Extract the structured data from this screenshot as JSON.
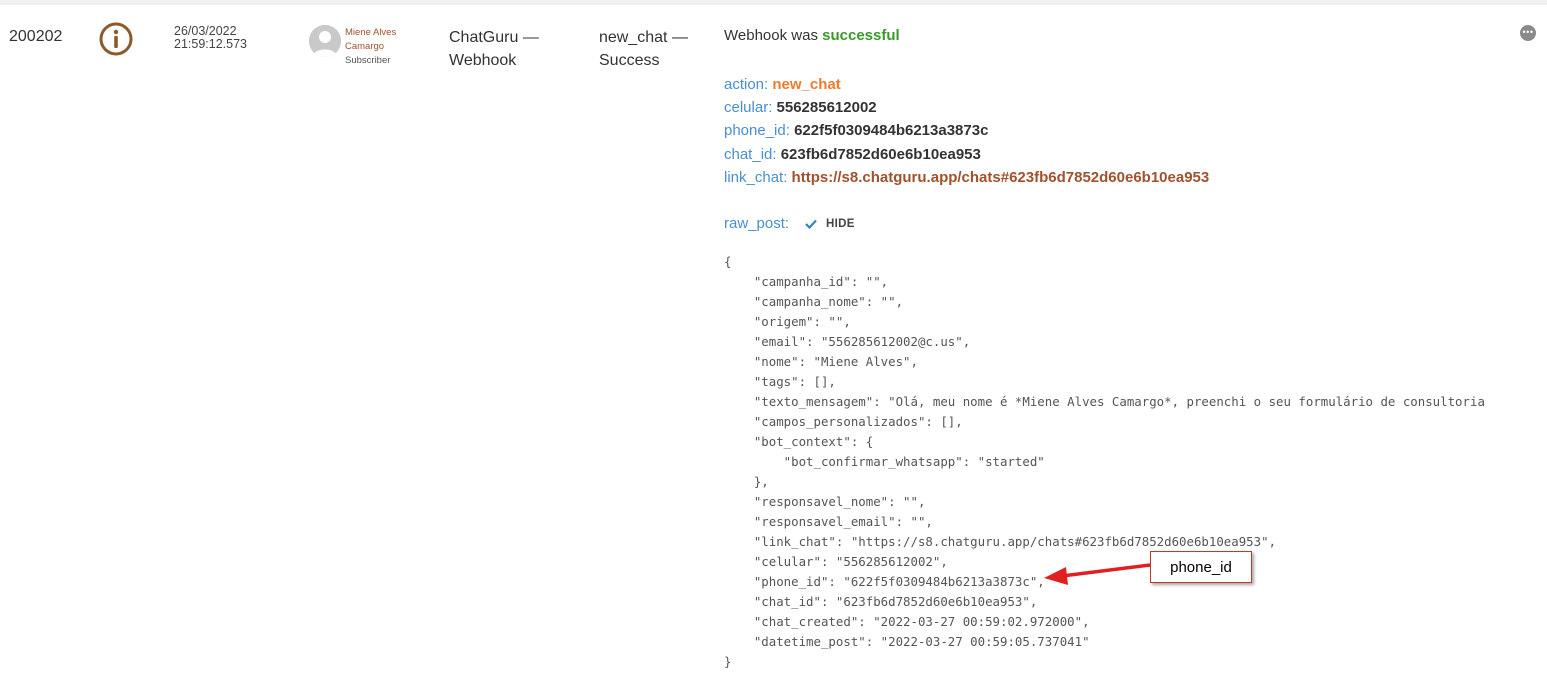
{
  "row": {
    "id": "200202",
    "date": "26/03/2022",
    "time": "21:59:12.573",
    "user": {
      "name_line1": "Miene Alves",
      "name_line2": "Camargo",
      "role": "Subscriber"
    },
    "source_line1": "ChatGuru —",
    "source_line2": "Webhook",
    "event_line1": "new_chat —",
    "event_line2": "Success"
  },
  "detail": {
    "headline_prefix": "Webhook was",
    "headline_status": "successful",
    "fields": [
      {
        "key": "action",
        "sep": ": ",
        "value": "new_chat"
      },
      {
        "key": "celular",
        "sep": ": ",
        "value": "556285612002"
      },
      {
        "key": "phone_id",
        "sep": ": ",
        "value": "622f5f0309484b6213a3873c"
      },
      {
        "key": "chat_id",
        "sep": ": ",
        "value": "623fb6d7852d60e6b10ea953"
      },
      {
        "key": "link_chat",
        "sep": ": ",
        "value": "https://s8.chatguru.app/chats#623fb6d7852d60e6b10ea953"
      }
    ],
    "raw_label": "raw_post:",
    "hide_label": "HIDE",
    "raw_json": "{\n    \"campanha_id\": \"\",\n    \"campanha_nome\": \"\",\n    \"origem\": \"\",\n    \"email\": \"556285612002@c.us\",\n    \"nome\": \"Miene Alves\",\n    \"tags\": [],\n    \"texto_mensagem\": \"Olá, meu nome é *Miene Alves Camargo*, preenchi o seu formulário de consultoria\n    \"campos_personalizados\": [],\n    \"bot_context\": {\n        \"bot_confirmar_whatsapp\": \"started\"\n    },\n    \"responsavel_nome\": \"\",\n    \"responsavel_email\": \"\",\n    \"link_chat\": \"https://s8.chatguru.app/chats#623fb6d7852d60e6b10ea953\",\n    \"celular\": \"556285612002\",\n    \"phone_id\": \"622f5f0309484b6213a3873c\",\n    \"chat_id\": \"623fb6d7852d60e6b10ea953\",\n    \"chat_created\": \"2022-03-27 00:59:02.972000\",\n    \"datetime_post\": \"2022-03-27 00:59:05.737041\"\n}"
  },
  "annotation": {
    "label": "phone_id"
  },
  "colors": {
    "success": "#3a9a2a",
    "key": "#4a8fcf",
    "action": "#f07a2d",
    "link": "#a0522d",
    "icon_brown": "#8b5a2b",
    "annotation_red": "#e02020"
  },
  "icons": {
    "status": "info-circle-icon",
    "avatar": "default-user-avatar",
    "hide": "checkmark-icon",
    "more": "ellipsis-icon",
    "annotation": "red-arrow"
  }
}
